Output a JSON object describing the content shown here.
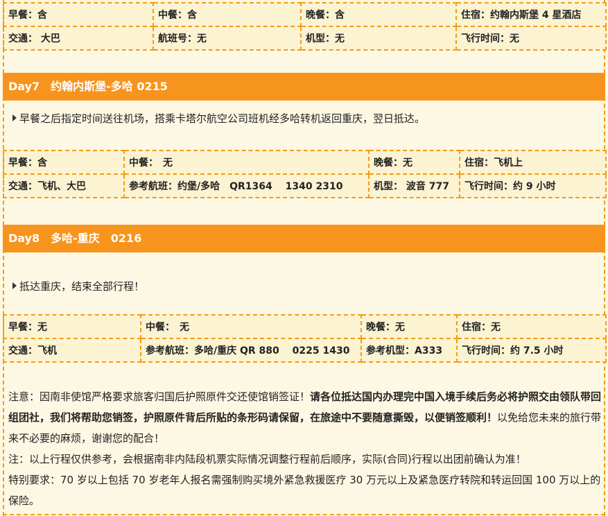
{
  "day6_table": {
    "row1": [
      "早餐：含",
      "中餐：含",
      "晚餐：含",
      "住宿：约翰内斯堡 4 星酒店"
    ],
    "row2": [
      "交通： 大巴",
      "航班号：无",
      "机型：无",
      "飞行时间：无"
    ]
  },
  "day7": {
    "header": "Day7　约翰内斯堡-多哈 0215",
    "desc": "早餐之后指定时间送往机场，搭乘卡塔尔航空公司班机经多哈转机返回重庆，翌日抵达。",
    "row1": [
      "早餐：含",
      "中餐：　无",
      "晚餐：无",
      "住宿：飞机上"
    ],
    "row2": [
      "交通：飞机、大巴",
      "参考航班：约堡/多哈　QR1364　 1340 2310",
      "机型： 波音 777",
      "飞行时间：约 9 小时"
    ]
  },
  "day8": {
    "header": "Day8　多哈-重庆　0216",
    "desc": "抵达重庆，结束全部行程！",
    "row1": [
      "早餐：无",
      "中餐：　无",
      "晚餐：无",
      "住宿：无"
    ],
    "row2": [
      "交通：飞机",
      "参考航班：多哈/重庆 QR 880　 0225 1430",
      "参考机型：A333",
      "飞行时间：约 7.5 小时"
    ]
  },
  "notes": {
    "n1_pre": "注意：因南非使馆严格要求旅客归国后护照原件交还使馆销签证！",
    "n1_bold": "请各位抵达国内办理完中国入境手续后务必将护照交由领队带回组团社，我们将帮助您销签，护照原件背后所贴的条形码请保留，在旅途中不要随意撕毁，以便销签顺利！",
    "n1_post": "以免给您未来的旅行带来不必要的麻烦，谢谢您的配合！",
    "n2": "注：以上行程仅供参考，会根据南非内陆段机票实际情况调整行程前后顺序，实际(合同)行程以出团前确认为准！",
    "n3": "特别要求：70 岁以上包括 70 岁老年人报名需强制购买境外紧急救援医疗 30 万元以上及紧急医疗转院和转运回国 100 万以上的保险。"
  }
}
